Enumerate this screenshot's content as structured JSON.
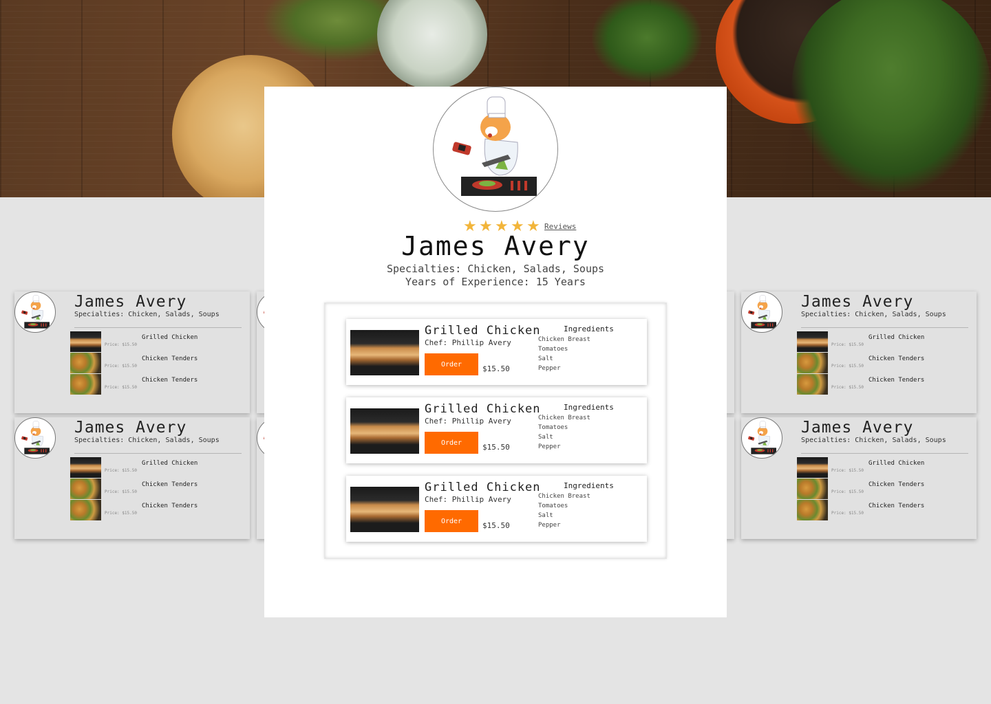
{
  "chef": {
    "name": "James Avery",
    "specialties": "Specialties: Chicken, Salads, Soups",
    "experience": "Years of Experience: 15 Years",
    "rating": 5,
    "reviews_link": "Reviews"
  },
  "menu_items": [
    {
      "name": "Grilled Chicken",
      "chef": "Chef: Phillip Avery",
      "order_label": "Order",
      "price": "$15.50",
      "ingredients_title": "Ingredients",
      "ingredients": [
        "Chicken Breast",
        "Tomatoes",
        "Salt",
        "Pepper"
      ]
    },
    {
      "name": "Grilled Chicken",
      "chef": "Chef: Phillip Avery",
      "order_label": "Order",
      "price": "$15.50",
      "ingredients_title": "Ingredients",
      "ingredients": [
        "Chicken Breast",
        "Tomatoes",
        "Salt",
        "Pepper"
      ]
    },
    {
      "name": "Grilled Chicken",
      "chef": "Chef: Phillip Avery",
      "order_label": "Order",
      "price": "$15.50",
      "ingredients_title": "Ingredients",
      "ingredients": [
        "Chicken Breast",
        "Tomatoes",
        "Salt",
        "Pepper"
      ]
    }
  ],
  "bg_card": {
    "name": "James Avery",
    "specialties": "Specialties: Chicken, Salads, Soups",
    "items": [
      {
        "name": "Grilled Chicken",
        "price": "Price: $15.50"
      },
      {
        "name": "Chicken Tenders",
        "price": "Price: $15.50"
      },
      {
        "name": "Chicken Tenders",
        "price": "Price: $15.50"
      }
    ]
  },
  "colors": {
    "accent": "#ff6a00",
    "star": "#f2b53a",
    "page_bg": "#e4e4e4"
  }
}
